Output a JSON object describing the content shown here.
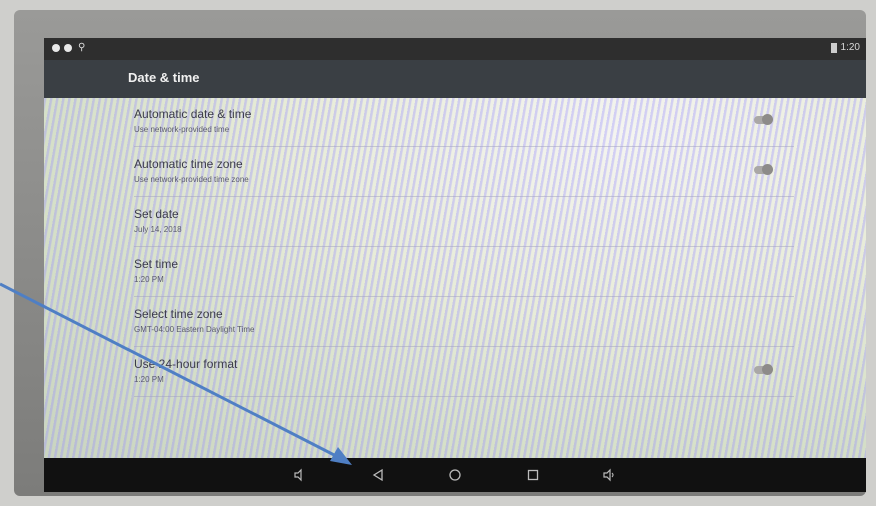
{
  "status_bar": {
    "time": "1:20"
  },
  "app_bar": {
    "title": "Date & time"
  },
  "settings": [
    {
      "title": "Automatic date & time",
      "subtitle": "Use network-provided time",
      "has_toggle": true
    },
    {
      "title": "Automatic time zone",
      "subtitle": "Use network-provided time zone",
      "has_toggle": true
    },
    {
      "title": "Set date",
      "subtitle": "July 14, 2018",
      "has_toggle": false
    },
    {
      "title": "Set time",
      "subtitle": "1:20 PM",
      "has_toggle": false
    },
    {
      "title": "Select time zone",
      "subtitle": "GMT-04:00 Eastern Daylight Time",
      "has_toggle": false
    },
    {
      "title": "Use 24-hour format",
      "subtitle": "1:20 PM",
      "has_toggle": true
    }
  ],
  "nav_bar": {
    "icons": [
      "volume-down-icon",
      "back-icon",
      "home-icon",
      "recents-icon",
      "volume-up-icon"
    ]
  },
  "colors": {
    "app_bar": "#3a3f44",
    "nav_bar": "#111111",
    "annotation_arrow": "#4f7fc4"
  }
}
